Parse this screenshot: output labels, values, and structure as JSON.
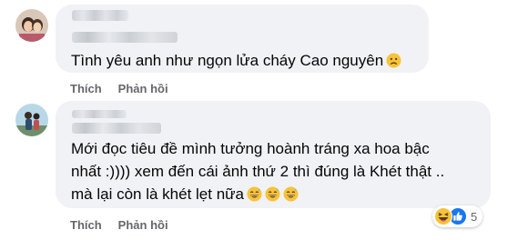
{
  "comments": [
    {
      "text": "Tình yêu anh như ngọn lửa cháy Cao nguyên",
      "emoji": "sad-face-emoji",
      "actions": {
        "like": "Thích",
        "reply": "Phản hồi"
      }
    },
    {
      "lines": [
        "Mới đọc tiêu đề mình tưởng hoành tráng xa hoa bậc",
        "nhất :)))) xem đến cái ảnh thứ 2 thì đúng là Khét thật ..",
        "mà lại còn là khét lẹt nữa"
      ],
      "emojis": [
        "grinning-sweat-emoji",
        "grinning-sweat-emoji",
        "grinning-sweat-emoji"
      ],
      "actions": {
        "like": "Thích",
        "reply": "Phản hồi"
      },
      "reactions": {
        "icons": [
          "haha-reaction-icon",
          "like-reaction-icon"
        ],
        "count": "5"
      }
    }
  ],
  "colors": {
    "bubble": "#f0f2f5",
    "text": "#050505",
    "secondary": "#65676b",
    "like_blue": "#1877f2",
    "emoji_yellow": "#f7c33a"
  }
}
